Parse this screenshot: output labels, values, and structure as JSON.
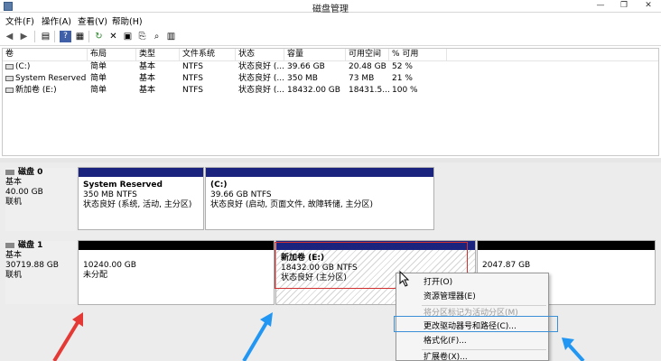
{
  "window": {
    "title": "磁盘管理",
    "controls": {
      "minimize": "—",
      "maximize": "❐",
      "close": "✕"
    }
  },
  "menu": [
    "文件(F)",
    "操作(A)",
    "查看(V)",
    "帮助(H)"
  ],
  "toolbar_icons": [
    "back-arrow-icon",
    "forward-arrow-icon",
    "details-view-icon",
    "help-icon",
    "list-view-icon",
    "refresh-icon",
    "delete-icon",
    "properties-icon",
    "export-icon",
    "search-icon",
    "volume-view-icon"
  ],
  "volume_list": {
    "columns": [
      "卷",
      "布局",
      "类型",
      "文件系统",
      "状态",
      "容量",
      "可用空间",
      "% 可用"
    ],
    "rows": [
      [
        "(C:)",
        "简单",
        "基本",
        "NTFS",
        "状态良好 (...",
        "39.66 GB",
        "20.48 GB",
        "52 %"
      ],
      [
        "System Reserved",
        "简单",
        "基本",
        "NTFS",
        "状态良好 (...",
        "350 MB",
        "73 MB",
        "21 %"
      ],
      [
        "新加卷 (E:)",
        "简单",
        "基本",
        "NTFS",
        "状态良好 (...",
        "18432.00 GB",
        "18431.5...",
        "100 %"
      ]
    ]
  },
  "disks": [
    {
      "name": "磁盘 0",
      "type": "基本",
      "size": "40.00 GB",
      "status": "联机",
      "partitions": [
        {
          "name": "System Reserved",
          "size": "350 MB NTFS",
          "status": "状态良好 (系统, 活动, 主分区)"
        },
        {
          "name": "(C:)",
          "size": "39.66 GB NTFS",
          "status": "状态良好 (启动, 页面文件, 故障转储, 主分区)"
        }
      ]
    },
    {
      "name": "磁盘 1",
      "type": "基本",
      "size": "30719.88 GB",
      "status": "联机",
      "partitions": [
        {
          "name": "",
          "size": "10240.00 GB",
          "status": "未分配"
        },
        {
          "name": "新加卷 (E:)",
          "size": "18432.00 GB NTFS",
          "status": "状态良好 (主分区)"
        },
        {
          "name": "",
          "size": "2047.87 GB",
          "status": ""
        }
      ]
    }
  ],
  "context_menu": {
    "items": [
      {
        "label": "打开(O)",
        "enabled": true
      },
      {
        "label": "资源管理器(E)",
        "enabled": true
      },
      {
        "label": "将分区标记为活动分区(M)",
        "enabled": false
      },
      {
        "label": "更改驱动器号和路径(C)...",
        "enabled": true
      },
      {
        "label": "格式化(F)...",
        "enabled": true
      },
      {
        "label": "扩展卷(X)...",
        "enabled": true
      }
    ]
  },
  "colors": {
    "primary_partition_bar": "#1a237e",
    "unallocated_bar": "#000000",
    "annotation_red": "#e53935",
    "annotation_blue": "#2196f3"
  }
}
